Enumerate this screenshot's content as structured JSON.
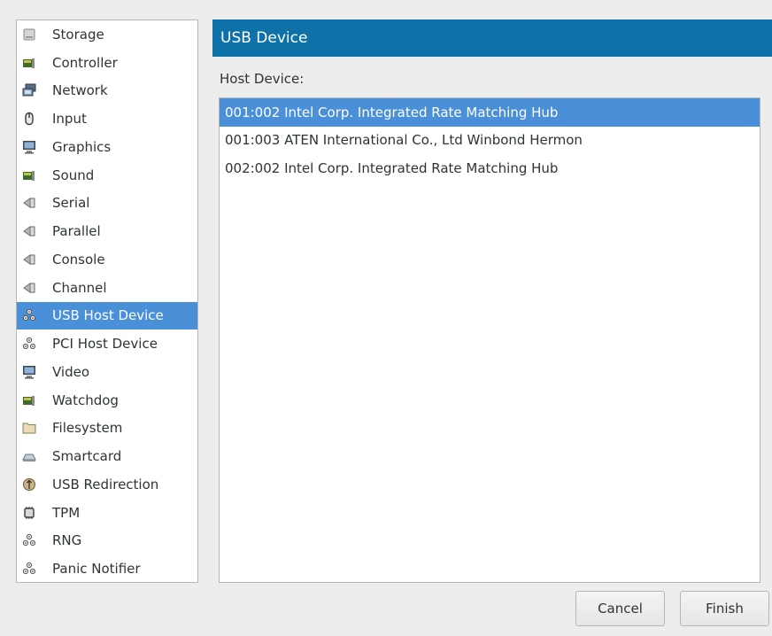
{
  "sidebar": {
    "items": [
      {
        "label": "Storage",
        "icon": "storage-icon"
      },
      {
        "label": "Controller",
        "icon": "controller-icon"
      },
      {
        "label": "Network",
        "icon": "network-icon"
      },
      {
        "label": "Input",
        "icon": "mouse-icon"
      },
      {
        "label": "Graphics",
        "icon": "monitor-icon"
      },
      {
        "label": "Sound",
        "icon": "sound-card-icon"
      },
      {
        "label": "Serial",
        "icon": "serial-port-icon"
      },
      {
        "label": "Parallel",
        "icon": "parallel-port-icon"
      },
      {
        "label": "Console",
        "icon": "console-port-icon"
      },
      {
        "label": "Channel",
        "icon": "channel-port-icon"
      },
      {
        "label": "USB Host Device",
        "icon": "usb-host-device-icon",
        "selected": true
      },
      {
        "label": "PCI Host Device",
        "icon": "pci-host-device-icon"
      },
      {
        "label": "Video",
        "icon": "video-monitor-icon"
      },
      {
        "label": "Watchdog",
        "icon": "watchdog-card-icon"
      },
      {
        "label": "Filesystem",
        "icon": "folder-icon"
      },
      {
        "label": "Smartcard",
        "icon": "smartcard-icon"
      },
      {
        "label": "USB Redirection",
        "icon": "usb-redirection-icon"
      },
      {
        "label": "TPM",
        "icon": "chip-icon"
      },
      {
        "label": "RNG",
        "icon": "rng-device-icon"
      },
      {
        "label": "Panic Notifier",
        "icon": "panic-notifier-icon"
      }
    ]
  },
  "main": {
    "title": "USB Device",
    "host_device_label": "Host Device:",
    "devices": [
      {
        "label": "001:002 Intel Corp. Integrated Rate Matching Hub",
        "selected": true
      },
      {
        "label": "001:003 ATEN International Co., Ltd Winbond Hermon",
        "selected": false
      },
      {
        "label": "002:002 Intel Corp. Integrated Rate Matching Hub",
        "selected": false
      }
    ]
  },
  "buttons": {
    "cancel": "Cancel",
    "finish": "Finish"
  },
  "colors": {
    "selection": "#4a90d9",
    "banner": "#0e72a8",
    "window_bg": "#ededed"
  }
}
